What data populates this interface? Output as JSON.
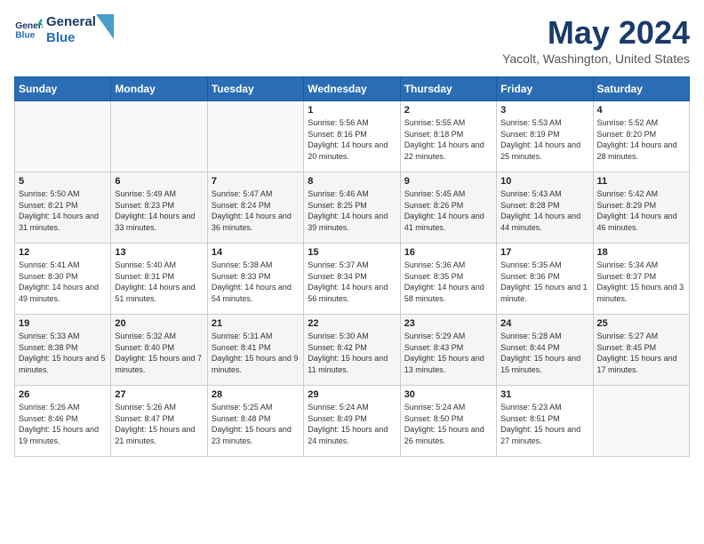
{
  "logo": {
    "line1": "General",
    "line2": "Blue"
  },
  "title": "May 2024",
  "location": "Yacolt, Washington, United States",
  "days_of_week": [
    "Sunday",
    "Monday",
    "Tuesday",
    "Wednesday",
    "Thursday",
    "Friday",
    "Saturday"
  ],
  "weeks": [
    [
      {
        "day": "",
        "sunrise": "",
        "sunset": "",
        "daylight": ""
      },
      {
        "day": "",
        "sunrise": "",
        "sunset": "",
        "daylight": ""
      },
      {
        "day": "",
        "sunrise": "",
        "sunset": "",
        "daylight": ""
      },
      {
        "day": "1",
        "sunrise": "Sunrise: 5:56 AM",
        "sunset": "Sunset: 8:16 PM",
        "daylight": "Daylight: 14 hours and 20 minutes."
      },
      {
        "day": "2",
        "sunrise": "Sunrise: 5:55 AM",
        "sunset": "Sunset: 8:18 PM",
        "daylight": "Daylight: 14 hours and 22 minutes."
      },
      {
        "day": "3",
        "sunrise": "Sunrise: 5:53 AM",
        "sunset": "Sunset: 8:19 PM",
        "daylight": "Daylight: 14 hours and 25 minutes."
      },
      {
        "day": "4",
        "sunrise": "Sunrise: 5:52 AM",
        "sunset": "Sunset: 8:20 PM",
        "daylight": "Daylight: 14 hours and 28 minutes."
      }
    ],
    [
      {
        "day": "5",
        "sunrise": "Sunrise: 5:50 AM",
        "sunset": "Sunset: 8:21 PM",
        "daylight": "Daylight: 14 hours and 31 minutes."
      },
      {
        "day": "6",
        "sunrise": "Sunrise: 5:49 AM",
        "sunset": "Sunset: 8:23 PM",
        "daylight": "Daylight: 14 hours and 33 minutes."
      },
      {
        "day": "7",
        "sunrise": "Sunrise: 5:47 AM",
        "sunset": "Sunset: 8:24 PM",
        "daylight": "Daylight: 14 hours and 36 minutes."
      },
      {
        "day": "8",
        "sunrise": "Sunrise: 5:46 AM",
        "sunset": "Sunset: 8:25 PM",
        "daylight": "Daylight: 14 hours and 39 minutes."
      },
      {
        "day": "9",
        "sunrise": "Sunrise: 5:45 AM",
        "sunset": "Sunset: 8:26 PM",
        "daylight": "Daylight: 14 hours and 41 minutes."
      },
      {
        "day": "10",
        "sunrise": "Sunrise: 5:43 AM",
        "sunset": "Sunset: 8:28 PM",
        "daylight": "Daylight: 14 hours and 44 minutes."
      },
      {
        "day": "11",
        "sunrise": "Sunrise: 5:42 AM",
        "sunset": "Sunset: 8:29 PM",
        "daylight": "Daylight: 14 hours and 46 minutes."
      }
    ],
    [
      {
        "day": "12",
        "sunrise": "Sunrise: 5:41 AM",
        "sunset": "Sunset: 8:30 PM",
        "daylight": "Daylight: 14 hours and 49 minutes."
      },
      {
        "day": "13",
        "sunrise": "Sunrise: 5:40 AM",
        "sunset": "Sunset: 8:31 PM",
        "daylight": "Daylight: 14 hours and 51 minutes."
      },
      {
        "day": "14",
        "sunrise": "Sunrise: 5:38 AM",
        "sunset": "Sunset: 8:33 PM",
        "daylight": "Daylight: 14 hours and 54 minutes."
      },
      {
        "day": "15",
        "sunrise": "Sunrise: 5:37 AM",
        "sunset": "Sunset: 8:34 PM",
        "daylight": "Daylight: 14 hours and 56 minutes."
      },
      {
        "day": "16",
        "sunrise": "Sunrise: 5:36 AM",
        "sunset": "Sunset: 8:35 PM",
        "daylight": "Daylight: 14 hours and 58 minutes."
      },
      {
        "day": "17",
        "sunrise": "Sunrise: 5:35 AM",
        "sunset": "Sunset: 8:36 PM",
        "daylight": "Daylight: 15 hours and 1 minute."
      },
      {
        "day": "18",
        "sunrise": "Sunrise: 5:34 AM",
        "sunset": "Sunset: 8:37 PM",
        "daylight": "Daylight: 15 hours and 3 minutes."
      }
    ],
    [
      {
        "day": "19",
        "sunrise": "Sunrise: 5:33 AM",
        "sunset": "Sunset: 8:38 PM",
        "daylight": "Daylight: 15 hours and 5 minutes."
      },
      {
        "day": "20",
        "sunrise": "Sunrise: 5:32 AM",
        "sunset": "Sunset: 8:40 PM",
        "daylight": "Daylight: 15 hours and 7 minutes."
      },
      {
        "day": "21",
        "sunrise": "Sunrise: 5:31 AM",
        "sunset": "Sunset: 8:41 PM",
        "daylight": "Daylight: 15 hours and 9 minutes."
      },
      {
        "day": "22",
        "sunrise": "Sunrise: 5:30 AM",
        "sunset": "Sunset: 8:42 PM",
        "daylight": "Daylight: 15 hours and 11 minutes."
      },
      {
        "day": "23",
        "sunrise": "Sunrise: 5:29 AM",
        "sunset": "Sunset: 8:43 PM",
        "daylight": "Daylight: 15 hours and 13 minutes."
      },
      {
        "day": "24",
        "sunrise": "Sunrise: 5:28 AM",
        "sunset": "Sunset: 8:44 PM",
        "daylight": "Daylight: 15 hours and 15 minutes."
      },
      {
        "day": "25",
        "sunrise": "Sunrise: 5:27 AM",
        "sunset": "Sunset: 8:45 PM",
        "daylight": "Daylight: 15 hours and 17 minutes."
      }
    ],
    [
      {
        "day": "26",
        "sunrise": "Sunrise: 5:26 AM",
        "sunset": "Sunset: 8:46 PM",
        "daylight": "Daylight: 15 hours and 19 minutes."
      },
      {
        "day": "27",
        "sunrise": "Sunrise: 5:26 AM",
        "sunset": "Sunset: 8:47 PM",
        "daylight": "Daylight: 15 hours and 21 minutes."
      },
      {
        "day": "28",
        "sunrise": "Sunrise: 5:25 AM",
        "sunset": "Sunset: 8:48 PM",
        "daylight": "Daylight: 15 hours and 23 minutes."
      },
      {
        "day": "29",
        "sunrise": "Sunrise: 5:24 AM",
        "sunset": "Sunset: 8:49 PM",
        "daylight": "Daylight: 15 hours and 24 minutes."
      },
      {
        "day": "30",
        "sunrise": "Sunrise: 5:24 AM",
        "sunset": "Sunset: 8:50 PM",
        "daylight": "Daylight: 15 hours and 26 minutes."
      },
      {
        "day": "31",
        "sunrise": "Sunrise: 5:23 AM",
        "sunset": "Sunset: 8:51 PM",
        "daylight": "Daylight: 15 hours and 27 minutes."
      },
      {
        "day": "",
        "sunrise": "",
        "sunset": "",
        "daylight": ""
      }
    ]
  ]
}
